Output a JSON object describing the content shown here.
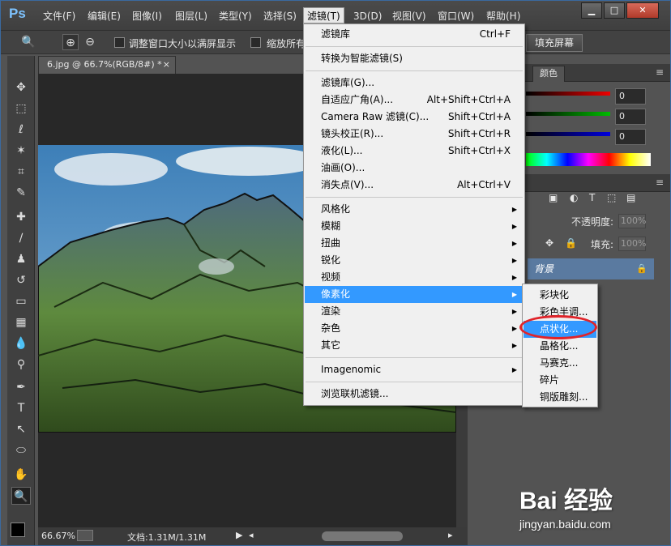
{
  "app": {
    "logo": "Ps"
  },
  "menubar": {
    "items": [
      "文件(F)",
      "编辑(E)",
      "图像(I)",
      "图层(L)",
      "类型(Y)",
      "选择(S)",
      "滤镜(T)",
      "3D(D)",
      "视图(V)",
      "窗口(W)",
      "帮助(H)"
    ],
    "active": "滤镜(T)"
  },
  "window_controls": {
    "minimize": "▁",
    "restore": "□",
    "close": "✕"
  },
  "options": {
    "checkbox1_label": "调整窗口大小以满屏显示",
    "checkbox2_label": "缩放所有",
    "fill_screen_label": "填充屏幕"
  },
  "document": {
    "tab_title": "6.jpg @ 66.7%(RGB/8#) *",
    "zoom": "66.67%",
    "doc_size": "文档:1.31M/1.31M"
  },
  "panels": {
    "color_tab": "颜色",
    "rgb_values": [
      "0",
      "0",
      "0"
    ],
    "opacity_label": "不透明度:",
    "opacity_value": "100%",
    "fill_label": "填充:",
    "fill_value": "100%",
    "layer_name": "背景"
  },
  "filter_menu": {
    "groups": [
      [
        {
          "label": "滤镜库",
          "shortcut": "Ctrl+F"
        }
      ],
      [
        {
          "label": "转换为智能滤镜(S)"
        }
      ],
      [
        {
          "label": "滤镜库(G)..."
        },
        {
          "label": "自适应广角(A)...",
          "shortcut": "Alt+Shift+Ctrl+A"
        },
        {
          "label": "Camera Raw 滤镜(C)...",
          "shortcut": "Shift+Ctrl+A"
        },
        {
          "label": "镜头校正(R)...",
          "shortcut": "Shift+Ctrl+R"
        },
        {
          "label": "液化(L)...",
          "shortcut": "Shift+Ctrl+X"
        },
        {
          "label": "油画(O)..."
        },
        {
          "label": "消失点(V)...",
          "shortcut": "Alt+Ctrl+V"
        }
      ],
      [
        {
          "label": "风格化"
        },
        {
          "label": "模糊"
        },
        {
          "label": "扭曲"
        },
        {
          "label": "锐化"
        },
        {
          "label": "视频"
        },
        {
          "label": "像素化"
        },
        {
          "label": "渲染"
        },
        {
          "label": "杂色"
        },
        {
          "label": "其它"
        }
      ],
      [
        {
          "label": "Imagenomic"
        }
      ],
      [
        {
          "label": "浏览联机滤镜..."
        }
      ]
    ],
    "highlighted": "像素化"
  },
  "pixelate_submenu": {
    "items": [
      "彩块化",
      "彩色半调...",
      "点状化...",
      "晶格化...",
      "马赛克...",
      "碎片",
      "铜版雕刻..."
    ],
    "highlighted": "点状化..."
  },
  "watermark": {
    "brand": "Bai 经验",
    "url": "jingyan.baidu.com"
  },
  "colors": {
    "menu_highlight": "#3399ff",
    "annotation_ring": "#e0242a"
  }
}
